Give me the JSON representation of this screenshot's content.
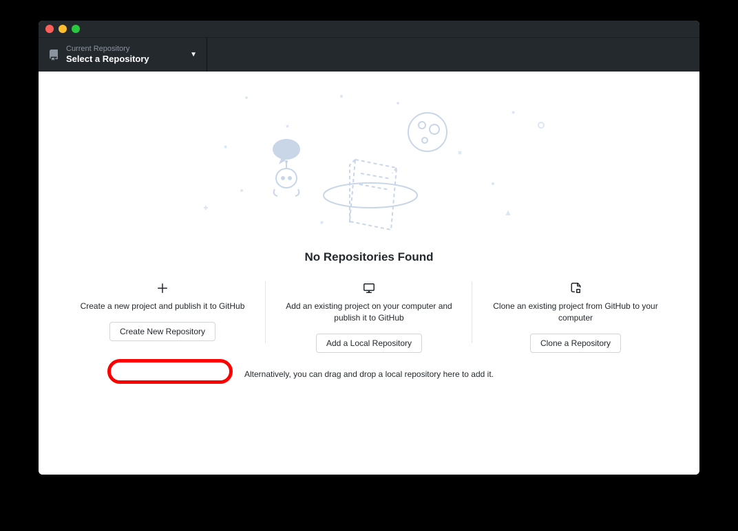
{
  "toolbar": {
    "repo_label": "Current Repository",
    "repo_name": "Select a Repository"
  },
  "blankslate": {
    "title": "No Repositories Found",
    "alt_text": "Alternatively, you can drag and drop a local repository here to add it."
  },
  "options": [
    {
      "icon": "plus-icon",
      "description": "Create a new project and publish it to GitHub",
      "button_label": "Create New Repository"
    },
    {
      "icon": "desktop-icon",
      "description": "Add an existing project on your computer and publish it to GitHub",
      "button_label": "Add a Local Repository"
    },
    {
      "icon": "repo-clone-icon",
      "description": "Clone an existing project from GitHub to your computer",
      "button_label": "Clone a Repository"
    }
  ],
  "highlight": {
    "target": "create-new-repository-button"
  }
}
